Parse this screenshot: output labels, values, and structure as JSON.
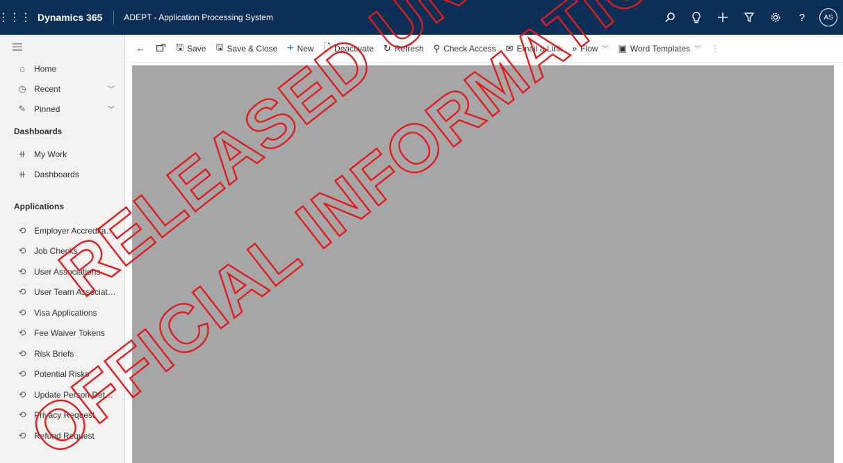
{
  "topbar": {
    "brand": "Dynamics 365",
    "app_title": "ADEPT - Application Processing System",
    "background_color": "#0c2f57",
    "actions": [
      {
        "name": "search-icon",
        "glyph": "⚲"
      },
      {
        "name": "lightbulb-icon",
        "glyph": "💡"
      },
      {
        "name": "add-icon",
        "glyph": "+"
      },
      {
        "name": "filter-icon",
        "glyph": "⛉"
      },
      {
        "name": "gear-icon",
        "glyph": "⚙"
      },
      {
        "name": "help-icon",
        "glyph": "?"
      }
    ],
    "avatar_initials": "AS"
  },
  "sidebar": {
    "menu_icon": "hamburger-icon",
    "top_items": [
      {
        "label": "Home",
        "icon": "home-icon"
      },
      {
        "label": "Recent",
        "icon": "clock-icon",
        "expandable": true
      },
      {
        "label": "Pinned",
        "icon": "pin-icon",
        "expandable": true
      }
    ],
    "dashboards_header": "Dashboards",
    "dashboard_items": [
      {
        "label": "My Work",
        "icon": "hash-icon"
      },
      {
        "label": "Dashboards",
        "icon": "hash-icon"
      }
    ],
    "applications_header": "Applications",
    "application_items": [
      {
        "label": "Employer Accreditati..."
      },
      {
        "label": "Job Checks"
      },
      {
        "label": "User Associations"
      },
      {
        "label": "User Team Associati..."
      },
      {
        "label": "Visa Applications"
      },
      {
        "label": "Fee Waiver Tokens"
      },
      {
        "label": "Risk Briefs"
      },
      {
        "label": "Potential Risks"
      },
      {
        "label": "Update Person Details"
      },
      {
        "label": "Privacy Request"
      },
      {
        "label": "Refund Request"
      }
    ]
  },
  "commandbar": {
    "back_icon": "back-arrow-icon",
    "popout_icon": "popout-icon",
    "save": "Save",
    "save_close": "Save & Close",
    "new": "New",
    "deactivate": "Deactivate",
    "refresh": "Refresh",
    "check_access": "Check Access",
    "email_link": "Email a Link",
    "flow": "Flow",
    "word_templates": "Word Templates",
    "more_icon": "more-icon"
  },
  "main": {
    "state": "loading",
    "background_color": "#a6a6a6"
  },
  "watermark": {
    "line1": "RELEASED UNDER THE",
    "line2": "OFFICIAL INFORMATION",
    "color": "#e21c1c"
  }
}
